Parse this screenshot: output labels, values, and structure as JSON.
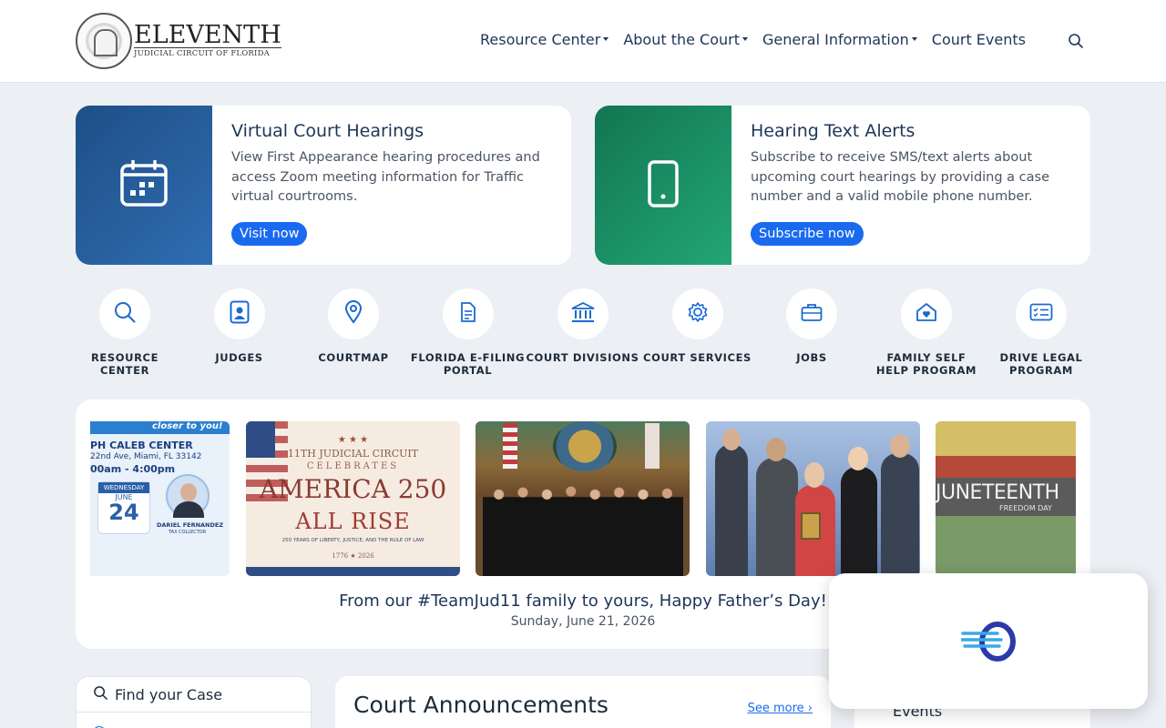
{
  "header": {
    "logo": {
      "title": "ELEVENTH",
      "subtitle": "JUDICIAL CIRCUIT OF FLORIDA",
      "seal_text": "ELEVENTH JUDICIAL CIRCUIT · MIAMI-DADE COUNTY, FLORIDA"
    },
    "nav": [
      {
        "label": "Resource Center",
        "dropdown": true
      },
      {
        "label": "About the Court",
        "dropdown": true
      },
      {
        "label": "General Information",
        "dropdown": true
      },
      {
        "label": "Court Events",
        "dropdown": false
      }
    ],
    "search_icon": "search-icon"
  },
  "cards": [
    {
      "title": "Virtual Court Hearings",
      "text": "View First Appearance hearing procedures and access Zoom meeting information for Traffic virtual courtrooms.",
      "button": "Visit now",
      "icon": "calendar-icon",
      "color": "#1e4f86"
    },
    {
      "title": "Hearing Text Alerts",
      "text": "Subscribe to receive SMS/text alerts about upcoming court hearings by providing a case number and a valid mobile phone number.",
      "button": "Subscribe now",
      "icon": "mobile-phone-icon",
      "color": "#1a8a60"
    }
  ],
  "quick_links": [
    {
      "label": "RESOURCE CENTER",
      "icon": "search-icon"
    },
    {
      "label": "JUDGES",
      "icon": "judge-badge-icon"
    },
    {
      "label": "COURTMAP",
      "icon": "map-pin-icon"
    },
    {
      "label": "FLORIDA E-FILING PORTAL",
      "icon": "document-icon"
    },
    {
      "label": "COURT DIVISIONS",
      "icon": "courthouse-icon"
    },
    {
      "label": "COURT SERVICES",
      "icon": "gear-icon"
    },
    {
      "label": "JOBS",
      "icon": "briefcase-icon"
    },
    {
      "label": "FAMILY SELF HELP PROGRAM",
      "icon": "home-heart-icon"
    },
    {
      "label": "DRIVE LEGAL PROGRAM",
      "icon": "id-card-icon"
    }
  ],
  "carousel": {
    "slides": [
      {
        "name": "tax-collector-event",
        "banner": "closer to you!",
        "location": "PH CALEB CENTER",
        "address": "22nd Ave, Miami, FL 33142",
        "hours": "00am - 4:00pm",
        "day": "WEDNESDAY",
        "month": "JUNE",
        "date": "24",
        "person": "DARIEL FERNANDEZ",
        "person_title": "TAX COLLECTOR"
      },
      {
        "name": "america-250",
        "line1": "11TH JUDICIAL CIRCUIT",
        "line2": "CELEBRATES",
        "line3": "AMERICA 250",
        "line4": "ALL RISE",
        "line5": "250 YEARS OF LIBERTY, JUSTICE, AND THE RULE OF LAW",
        "years": "1776 ★ 2026"
      },
      {
        "name": "judges-group-photo"
      },
      {
        "name": "award-group-photo"
      },
      {
        "name": "juneteenth",
        "title": "JUNETEENTH",
        "subtitle": "FREEDOM DAY"
      }
    ],
    "caption": "From our #TeamJud11 family to yours, Happy Father’s Day!",
    "date": "Sunday, June 21, 2026"
  },
  "find_case": {
    "label": "Find your Case"
  },
  "announcements": {
    "title": "Court Announcements",
    "see_more": "See more ›"
  },
  "events": {
    "title": "Events"
  },
  "widget": {
    "icon": "chat-widget-logo-icon"
  }
}
